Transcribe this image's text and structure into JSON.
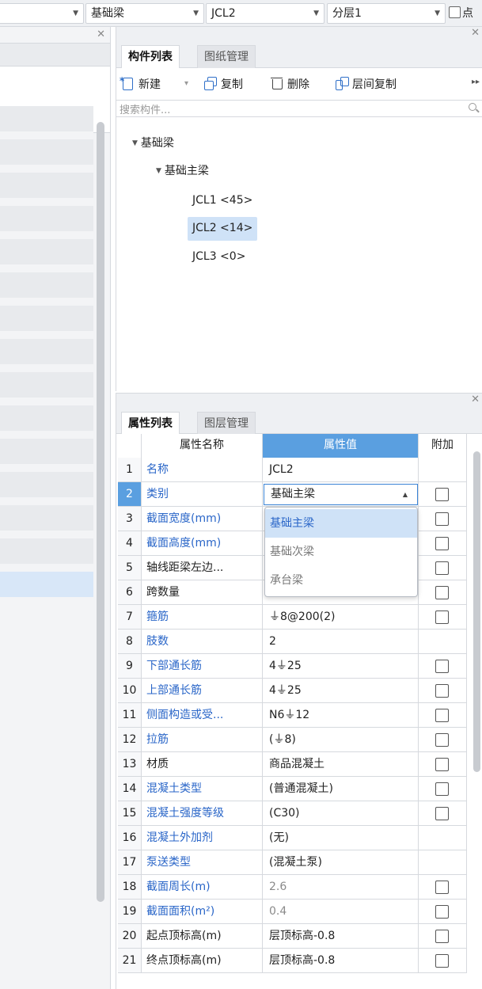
{
  "topbar": {
    "combo_blank": "",
    "combo_type": "基础梁",
    "combo_component": "JCL2",
    "combo_layer": "分层1",
    "check_label": "点"
  },
  "comp_panel": {
    "tabs": [
      "构件列表",
      "图纸管理"
    ],
    "toolbar": {
      "new_label": "新建",
      "copy_label": "复制",
      "delete_label": "删除",
      "floor_copy_label": "层间复制"
    },
    "search_placeholder": "搜索构件...",
    "tree": {
      "root": "基础梁",
      "group": "基础主梁",
      "items": [
        "JCL1 <45>",
        "JCL2 <14>",
        "JCL3 <0>"
      ]
    }
  },
  "prop_panel": {
    "tabs": [
      "属性列表",
      "图层管理"
    ],
    "headers": {
      "name": "属性名称",
      "value": "属性值",
      "extra": "附加"
    },
    "rows": [
      {
        "num": "1",
        "name": "名称",
        "value": "JCL2",
        "check": false
      },
      {
        "num": "2",
        "name": "类别",
        "value": "基础主梁",
        "check": true
      },
      {
        "num": "3",
        "name": "截面宽度(mm)",
        "value": "",
        "check": true
      },
      {
        "num": "4",
        "name": "截面高度(mm)",
        "value": "",
        "check": true
      },
      {
        "num": "5",
        "name": "轴线距梁左边...",
        "value": "",
        "check": true
      },
      {
        "num": "6",
        "name": "跨数量",
        "value": "",
        "check": true
      },
      {
        "num": "7",
        "name": "箍筋",
        "value": "⏚8@200(2)",
        "check": true
      },
      {
        "num": "8",
        "name": "肢数",
        "value": "2",
        "check": false
      },
      {
        "num": "9",
        "name": "下部通长筋",
        "value": "4⏚25",
        "check": true
      },
      {
        "num": "10",
        "name": "上部通长筋",
        "value": "4⏚25",
        "check": true
      },
      {
        "num": "11",
        "name": "侧面构造或受...",
        "value": "N6⏚12",
        "check": true
      },
      {
        "num": "12",
        "name": "拉筋",
        "value": "(⏚8)",
        "check": true
      },
      {
        "num": "13",
        "name": "材质",
        "value": "商品混凝土",
        "check": true
      },
      {
        "num": "14",
        "name": "混凝土类型",
        "value": "(普通混凝土)",
        "check": true
      },
      {
        "num": "15",
        "name": "混凝土强度等级",
        "value": "(C30)",
        "check": true
      },
      {
        "num": "16",
        "name": "混凝土外加剂",
        "value": "(无)",
        "check": false
      },
      {
        "num": "17",
        "name": "泵送类型",
        "value": "(混凝土泵)",
        "check": false
      },
      {
        "num": "18",
        "name": "截面周长(m)",
        "value": "2.6",
        "check": true
      },
      {
        "num": "19",
        "name": "截面面积(m²)",
        "value": "0.4",
        "check": true
      },
      {
        "num": "20",
        "name": "起点顶标高(m)",
        "value": "层顶标高-0.8",
        "check": true
      },
      {
        "num": "21",
        "name": "终点顶标高(m)",
        "value": "层顶标高-0.8",
        "check": true
      }
    ],
    "dropdown_options": [
      "基础主梁",
      "基础次梁",
      "承台梁"
    ]
  },
  "colors": {
    "accent": "#5a9fe0",
    "link": "#2a66c8",
    "selection": "#cfe2f7"
  }
}
